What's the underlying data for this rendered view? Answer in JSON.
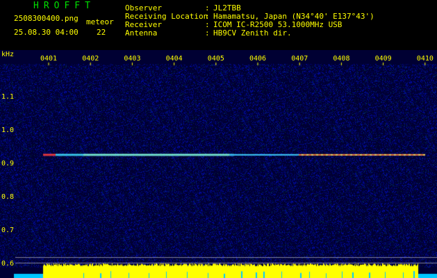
{
  "header": {
    "logo": "HROFFT",
    "filename": "2508300400.png",
    "datetime": "25.08.30 04:00",
    "meteor_label": "meteor",
    "meteor_count": "22",
    "fields": [
      {
        "label": "Observer",
        "sep": ":",
        "value": "JL2TBB"
      },
      {
        "label": "Receiving Location",
        "sep": ":",
        "value": "Hamamatsu, Japan (N34°40' E137°43')"
      },
      {
        "label": "Receiver",
        "sep": ":",
        "value": "ICOM IC-R2500 53.1000MHz USB"
      },
      {
        "label": "Antenna",
        "sep": ":",
        "value": "HB9CV Zenith dir."
      }
    ]
  },
  "spectrogram": {
    "unit_label": "kHz",
    "time_ticks": [
      "0401",
      "0402",
      "0403",
      "0404",
      "0405",
      "0406",
      "0407",
      "0408",
      "0409",
      "0410"
    ],
    "freq_ticks": [
      "1.1",
      "1.0",
      "0.9",
      "0.8",
      "0.7",
      "0.6"
    ],
    "signal_freq_khz": 0.93,
    "colors": {
      "background": "#000033",
      "text": "#ffff00",
      "signal": "#80ffe0",
      "level_bar": "#ffff00",
      "level_dip": "#00c8ff"
    }
  }
}
